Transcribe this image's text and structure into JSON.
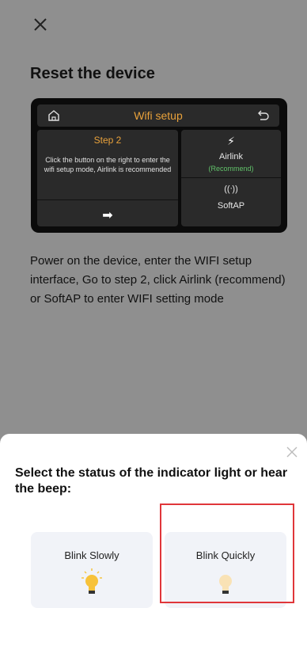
{
  "page": {
    "title": "Reset the device",
    "description": "Power on the device, enter the WIFI setup interface, Go to step 2, click Airlink (recommend) or SoftAP to enter WIFI setting mode"
  },
  "device_screen": {
    "header_title": "Wifi setup",
    "step_label": "Step 2",
    "instruction": "Click the button on the right to enter the wifi setup mode, Airlink is recommended",
    "arrow": "➡",
    "airlink_label": "Airlink",
    "airlink_note": "(Recommend)",
    "softap_label": "SoftAP",
    "bolt": "⚡",
    "antenna": "((ᐧ))"
  },
  "sheet": {
    "title": "Select the status of the indicator light or hear the beep:",
    "options": [
      {
        "label": "Blink Slowly"
      },
      {
        "label": "Blink Quickly"
      }
    ]
  },
  "colors": {
    "accent_orange": "#e9a23b",
    "recommend_green": "#61c36a",
    "highlight_red": "#e0363a",
    "dim_overlay": "#8f8f8f"
  }
}
